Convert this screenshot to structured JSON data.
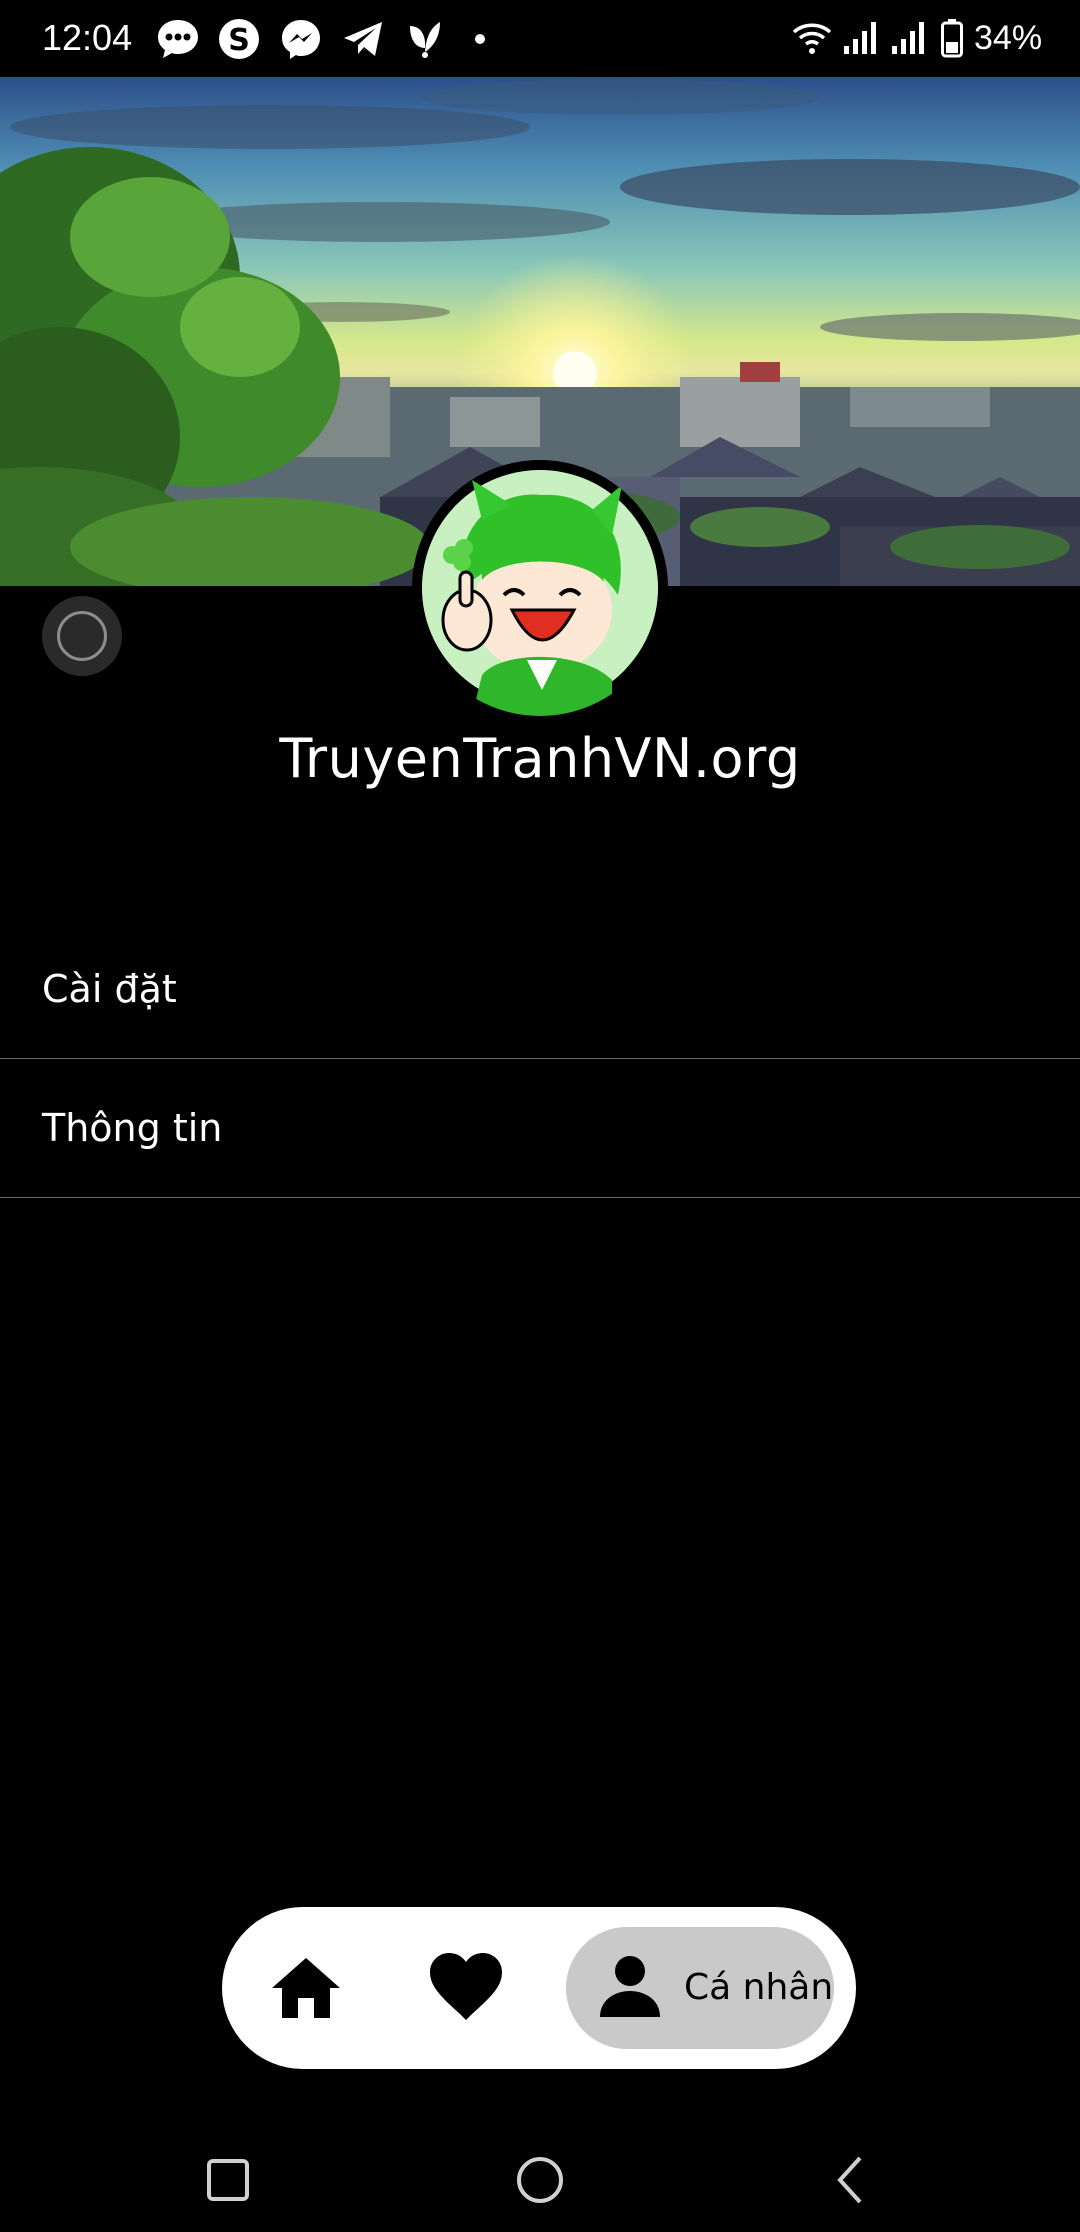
{
  "status_bar": {
    "time": "12:04",
    "battery": "34%",
    "notification_icons": [
      "messages-icon",
      "skype-icon",
      "messenger-icon",
      "telegram-icon",
      "app-icon",
      "dot-icon"
    ],
    "system_icons": [
      "wifi-icon",
      "signal-icon",
      "signal-icon",
      "battery-icon"
    ]
  },
  "profile": {
    "site_name": "TruyenTranhVN.org"
  },
  "menu": {
    "items": [
      {
        "label": "Cài đặt"
      },
      {
        "label": "Thông tin"
      }
    ]
  },
  "tabbar": {
    "tabs": [
      {
        "icon": "home-icon"
      },
      {
        "icon": "heart-icon"
      },
      {
        "icon": "person-icon",
        "label": "Cá nhân",
        "active": true
      }
    ],
    "active_bg": "#c9c9c9"
  },
  "system_nav": [
    "recents-icon",
    "home-circle-icon",
    "back-icon"
  ]
}
